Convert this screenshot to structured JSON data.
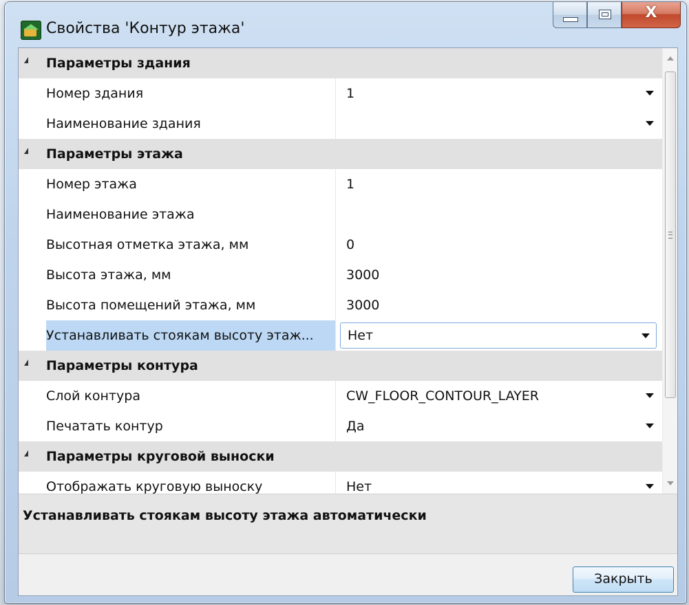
{
  "window": {
    "title": "Свойства 'Контур этажа'",
    "close_glyph": "X"
  },
  "categories": [
    {
      "label": "Параметры здания",
      "properties": [
        {
          "name": "Номер здания",
          "value": "1",
          "dropdown": true
        },
        {
          "name": "Наименование здания",
          "value": "",
          "dropdown": true
        }
      ]
    },
    {
      "label": "Параметры этажа",
      "properties": [
        {
          "name": "Номер этажа",
          "value": "1",
          "dropdown": false
        },
        {
          "name": "Наименование этажа",
          "value": "",
          "dropdown": false
        },
        {
          "name": "Высотная отметка этажа, мм",
          "value": "0",
          "dropdown": false
        },
        {
          "name": "Высота этажа, мм",
          "value": "3000",
          "dropdown": false
        },
        {
          "name": "Высота помещений этажа, мм",
          "value": "3000",
          "dropdown": false
        },
        {
          "name": "Устанавливать стоякам высоту этаж...",
          "value": "Нет",
          "dropdown": true,
          "selected": true
        }
      ]
    },
    {
      "label": "Параметры контура",
      "properties": [
        {
          "name": "Слой контура",
          "value": "CW_FLOOR_CONTOUR_LAYER",
          "dropdown": true
        },
        {
          "name": "Печатать контур",
          "value": "Да",
          "dropdown": true
        }
      ]
    },
    {
      "label": "Параметры круговой выноски",
      "properties": [
        {
          "name": "Отображать круговую выноску",
          "value": "Нет",
          "dropdown": true
        }
      ]
    }
  ],
  "description": "Устанавливать стоякам высоту этажа автоматически",
  "buttons": {
    "close_label": "Закрыть"
  },
  "colors": {
    "selection": "#bcd8f5",
    "category_bg": "#e1e1e1",
    "close_caption": "#c1492b"
  }
}
